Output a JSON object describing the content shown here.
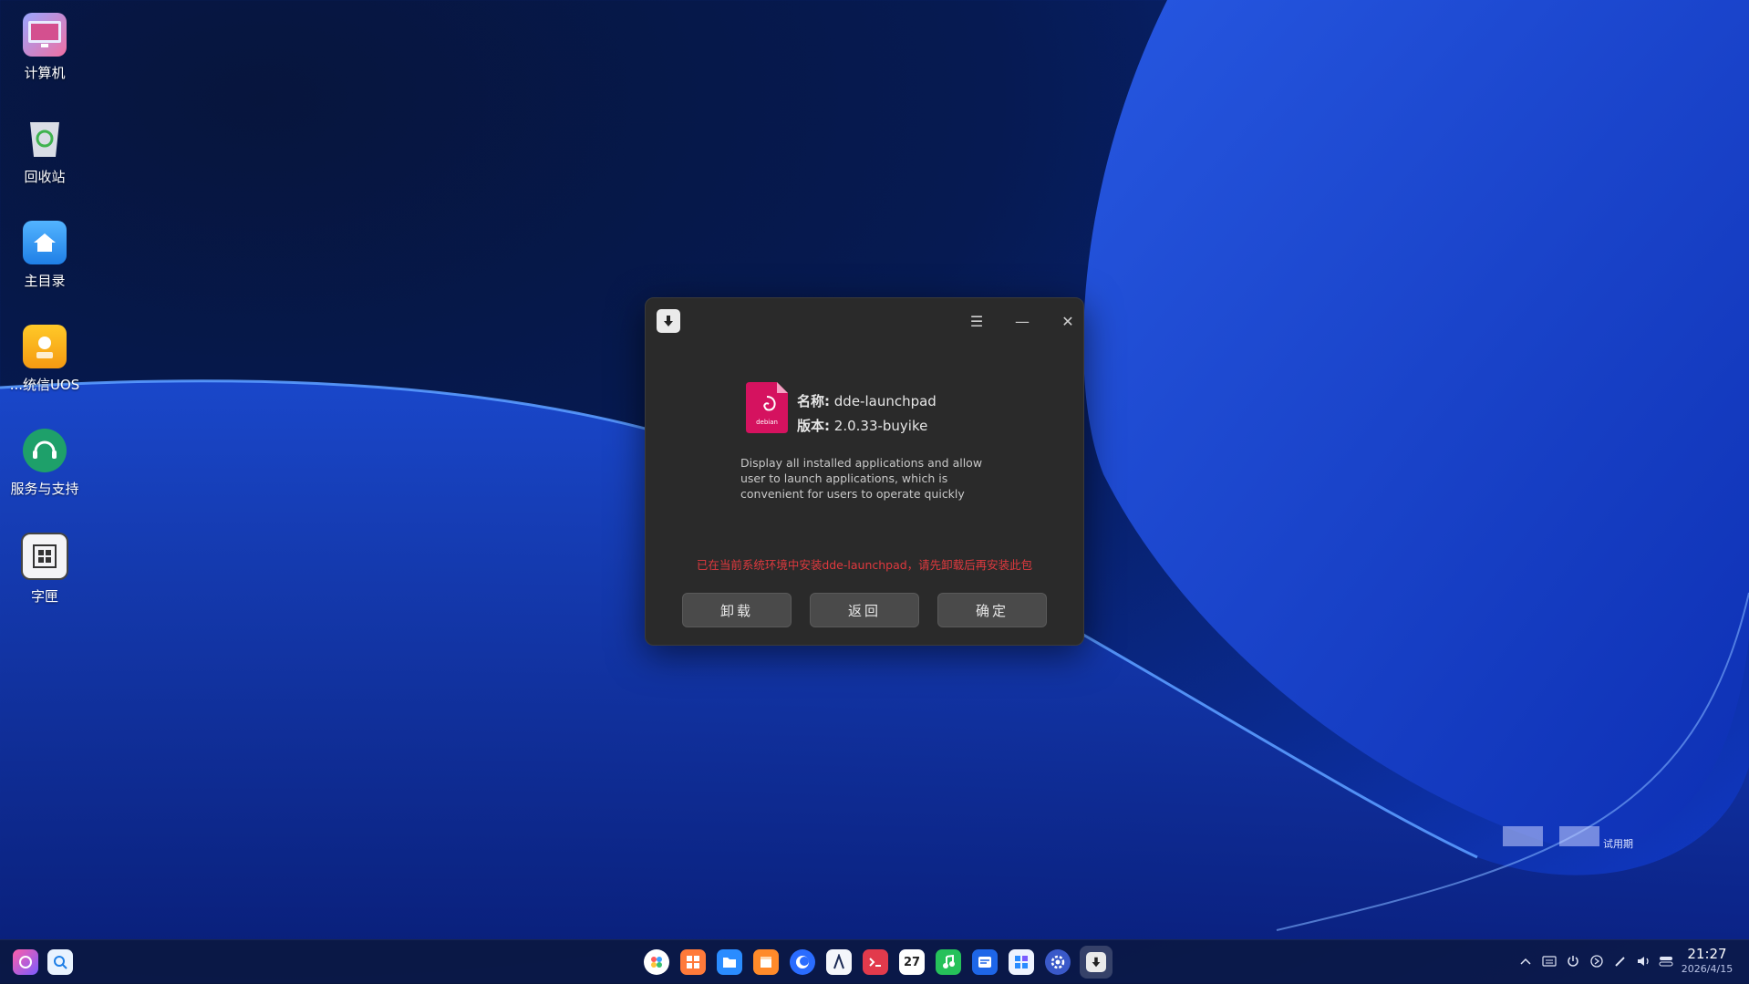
{
  "desktop": {
    "icons": [
      {
        "label": "计算机",
        "icon": "computer-icon"
      },
      {
        "label": "回收站",
        "icon": "trash-icon"
      },
      {
        "label": "主目录",
        "icon": "home-folder-icon"
      },
      {
        "label": "...统信UOS",
        "icon": "uos-icon"
      },
      {
        "label": "服务与支持",
        "icon": "support-icon"
      },
      {
        "label": "字匣",
        "icon": "font-manager-icon"
      }
    ]
  },
  "dialog": {
    "icon": "download-icon",
    "menu_icon": "☰",
    "minimize_icon": "—",
    "close_icon": "✕",
    "package_icon_text": "debian",
    "name_key": "名称:",
    "name_value": "dde-launchpad",
    "version_key": "版本:",
    "version_value": "2.0.33-buyike",
    "description": "Display all installed applications and allow user to launch applications, which is convenient for users to operate quickly",
    "warning": "已在当前系统环境中安装dde-launchpad，请先卸载后再安装此包",
    "buttons": {
      "uninstall": "卸载",
      "back": "返回",
      "confirm": "确定"
    }
  },
  "watermark": {
    "text": "试用期"
  },
  "taskbar": {
    "left_icons": [
      "launcher-icon",
      "search-icon"
    ],
    "center_icons": [
      "multitasking-icon",
      "app-store-icon",
      "file-manager-icon",
      "package-icon",
      "browser-icon",
      "draw-icon",
      "terminal-icon",
      "calendar-icon",
      "music-icon",
      "mail-icon",
      "control-center-icon",
      "settings-icon",
      "installer-icon"
    ],
    "calendar_day": "27",
    "tray_icons": [
      "chevron-up-icon",
      "keyboard-icon",
      "power-icon",
      "network-icon",
      "pen-icon",
      "volume-icon",
      "toggle-icon"
    ],
    "time": "21:27",
    "date": "2026/4/15"
  },
  "colors": {
    "warning": "#e0393e",
    "dialog_bg": "#2a2a2a",
    "package_pink": "#d5125f"
  }
}
